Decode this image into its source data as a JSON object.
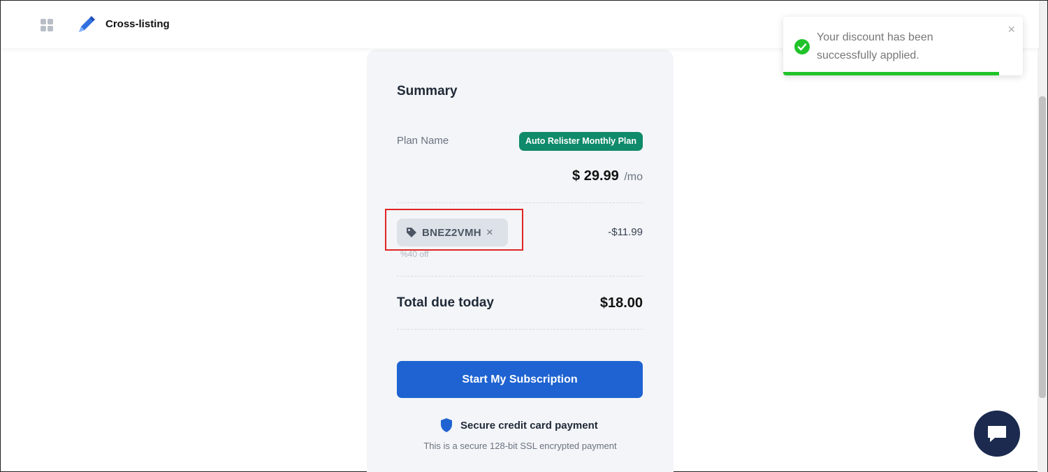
{
  "header": {
    "brand": "Cross-listing",
    "apps_icon": "grid-icon",
    "logo_icon": "pencil-logo-icon"
  },
  "summary": {
    "title": "Summary",
    "plan_label": "Plan Name",
    "plan_badge": "Auto Relister Monthly Plan",
    "price": "$ 29.99",
    "price_period": "/mo",
    "coupon_code": "BNEZ2VMH",
    "coupon_note": "%40 off",
    "discount_amount": "-$11.99",
    "total_label": "Total due today",
    "total_value": "$18.00",
    "cta_label": "Start My Subscription",
    "secure_title": "Secure credit card payment",
    "secure_subtitle": "This is a secure 128-bit SSL encrypted payment"
  },
  "toast": {
    "message": "Your discount has been successfully applied.",
    "close_glyph": "×",
    "progress_fraction": 0.9
  },
  "colors": {
    "primary": "#1e63d1",
    "badge": "#0f8a6a",
    "success": "#21c32a",
    "highlight": "#e02424",
    "chat": "#1b2a4e"
  }
}
